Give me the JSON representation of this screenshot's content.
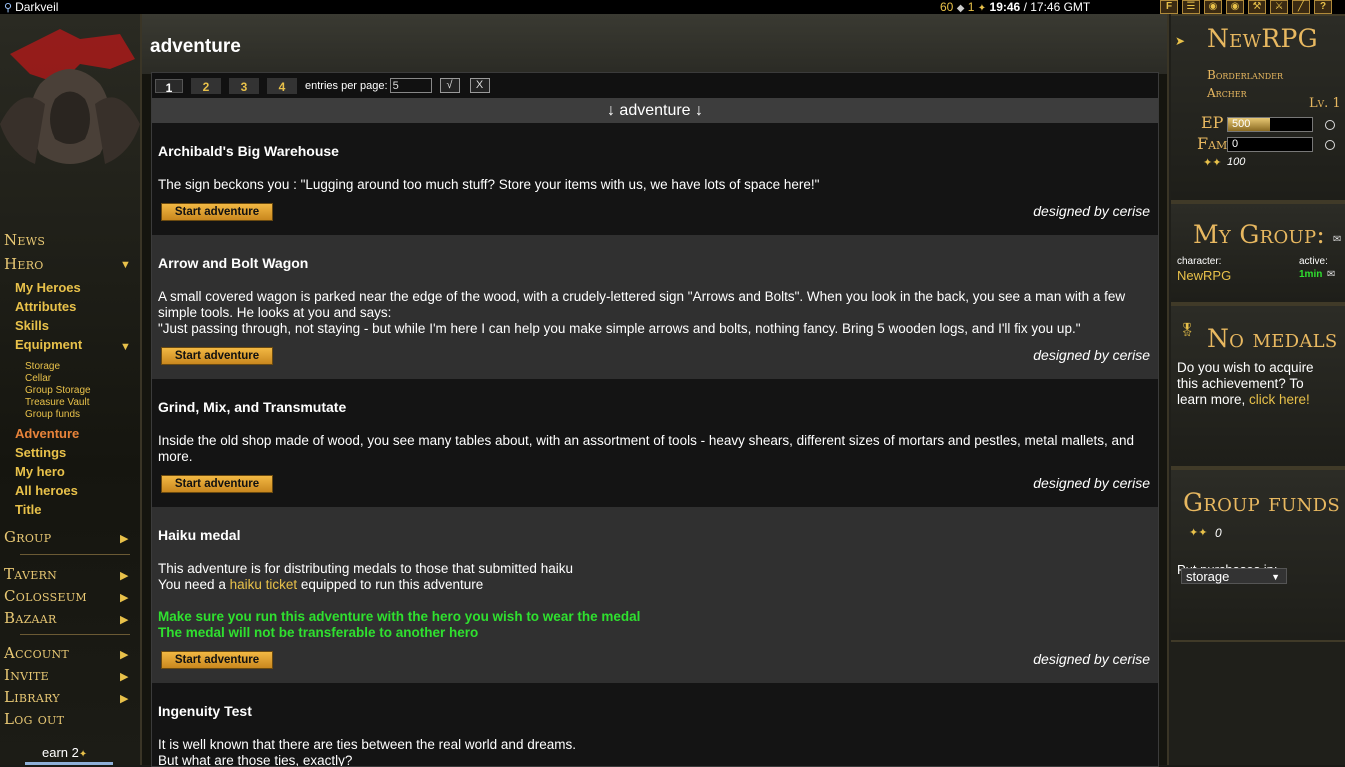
{
  "topbar": {
    "app_name": "Darkveil",
    "gold": "60",
    "gems": "1",
    "server_time": "19:46",
    "gmt_time": "/ 17:46 GMT",
    "icons": [
      "forum-icon",
      "scroll-icon",
      "item-icon",
      "skill-icon",
      "hammer-icon",
      "sword-icon",
      "staff-icon",
      "help-icon"
    ]
  },
  "sidebar": {
    "news": "News",
    "hero": "Hero",
    "hero_items": [
      "My Heroes",
      "Attributes",
      "Skills",
      "Equipment"
    ],
    "equipment_items": [
      "Storage",
      "Cellar",
      "Group Storage",
      "Treasure Vault",
      "Group funds"
    ],
    "hero_items2": [
      "Adventure",
      "Settings",
      "My hero",
      "All heroes",
      "Title"
    ],
    "active_item": "Adventure",
    "group": "Group",
    "tavern": "Tavern",
    "colosseum": "Colosseum",
    "bazaar": "Bazaar",
    "account": "Account",
    "invite": "Invite",
    "library": "Library",
    "logout": "Log out",
    "earn": "earn 2"
  },
  "main": {
    "title": "adventure",
    "pages": [
      "1",
      "2",
      "3",
      "4"
    ],
    "current_page": "1",
    "entries_label": "entries per page:",
    "entries_value": "5",
    "apply_label": "√",
    "clear_label": "X",
    "section_header": "↓ adventure ↓",
    "start_label": "Start adventure",
    "adventures": [
      {
        "name": "Archibald's Big Warehouse",
        "desc": "The sign beckons you : \"Lugging around too much stuff? Store your items with us, we have lots of space here!\"",
        "designer": "designed by cerise"
      },
      {
        "name": "Arrow and Bolt Wagon",
        "desc": "A small covered wagon is parked near the edge of the wood, with a crudely-lettered sign \"Arrows and Bolts\". When you look in the back, you see a man with a few simple tools. He looks at you and says:",
        "desc2": "\"Just passing through, not staying - but while I'm here I can help you make simple arrows and bolts, nothing fancy. Bring 5 wooden logs, and I'll fix you up.\"",
        "designer": "designed by cerise"
      },
      {
        "name": "Grind, Mix, and Transmutate",
        "desc": "Inside the old shop made of wood, you see many tables about, with an assortment of tools - heavy shears, different sizes of mortars and pestles, metal mallets, and more.",
        "designer": "designed by cerise"
      },
      {
        "name": "Haiku medal",
        "desc": "This adventure is for distributing medals to those that submitted haiku",
        "need_prefix": "You need a ",
        "need_link": "haiku ticket",
        "need_suffix": " equipped to run this adventure",
        "warn1": "Make sure you run this adventure with the hero you wish to wear the medal",
        "warn2": "The medal will not be transferable to another hero",
        "designer": "designed by cerise"
      },
      {
        "name": "Ingenuity Test",
        "desc": "It is well known that there are ties between the real world and dreams.",
        "desc2": "But what are those ties, exactly?"
      }
    ]
  },
  "rightbar": {
    "hero_name": "NewRPG",
    "race": "Borderlander",
    "class": "Archer",
    "level": "Lv. 1",
    "ep_label": "EP",
    "ep_value": "500",
    "ep_fraction": 0.5,
    "fame_label": "Fame",
    "fame_value": "0",
    "gold_value": "100",
    "group_title": "My Group:",
    "character_label": "character:",
    "active_label": "active:",
    "group_member": "NewRPG",
    "active_value": "1min",
    "medals_title": "No medals",
    "medals_text": "Do you wish to acquire this achievement? To learn more, ",
    "medals_link": "click here!",
    "funds_title": "Group funds",
    "funds_value": "0",
    "purchases_label": "Put purchases in:",
    "purchases_value": "storage"
  }
}
